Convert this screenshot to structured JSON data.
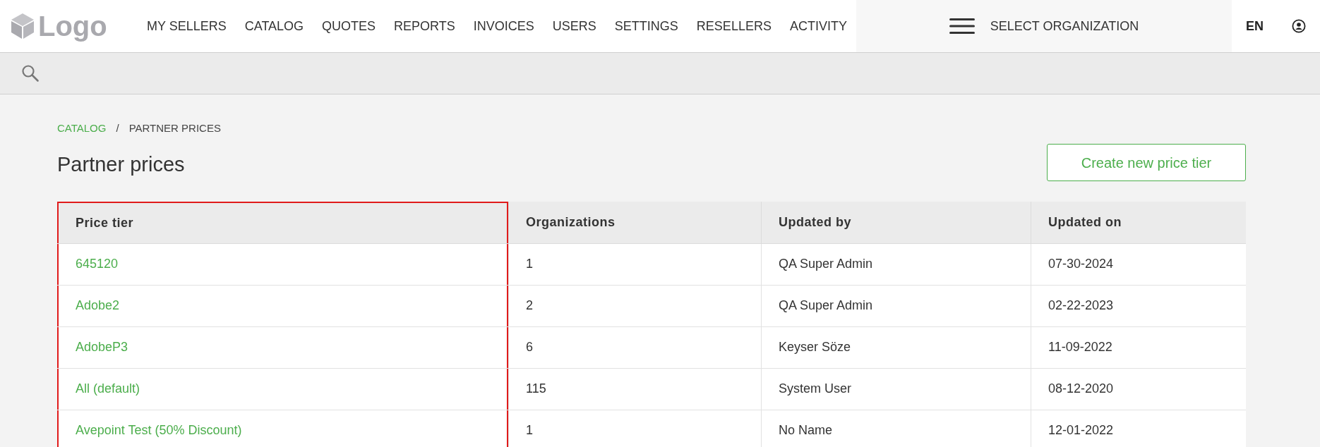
{
  "header": {
    "logo": "Logo",
    "nav": [
      "MY SELLERS",
      "CATALOG",
      "QUOTES",
      "REPORTS",
      "INVOICES",
      "USERS",
      "SETTINGS",
      "RESELLERS",
      "ACTIVITY"
    ],
    "organization_selector": "SELECT ORGANIZATION",
    "language": "EN"
  },
  "breadcrumb": [
    {
      "label": "CATALOG",
      "link": true
    },
    {
      "label": "/",
      "link": false
    },
    {
      "label": "PARTNER PRICES",
      "link": false
    }
  ],
  "page_title": "Partner prices",
  "create_button": "Create new price tier",
  "table": {
    "columns": [
      {
        "label": "Price tier",
        "highlighted": true
      },
      {
        "label": "Organizations",
        "highlighted": false
      },
      {
        "label": "Updated by",
        "highlighted": false
      },
      {
        "label": "Updated on",
        "highlighted": false
      }
    ],
    "rows": [
      [
        "645120",
        "1",
        "QA Super Admin",
        "07-30-2024"
      ],
      [
        "Adobe2",
        "2",
        "QA Super Admin",
        "02-22-2023"
      ],
      [
        "AdobeP3",
        "6",
        "Keyser Söze",
        "11-09-2022"
      ],
      [
        "All (default)",
        "115",
        "System User",
        "08-12-2020"
      ],
      [
        "Avepoint Test (50% Discount)",
        "1",
        "No Name",
        "12-01-2022"
      ]
    ]
  }
}
